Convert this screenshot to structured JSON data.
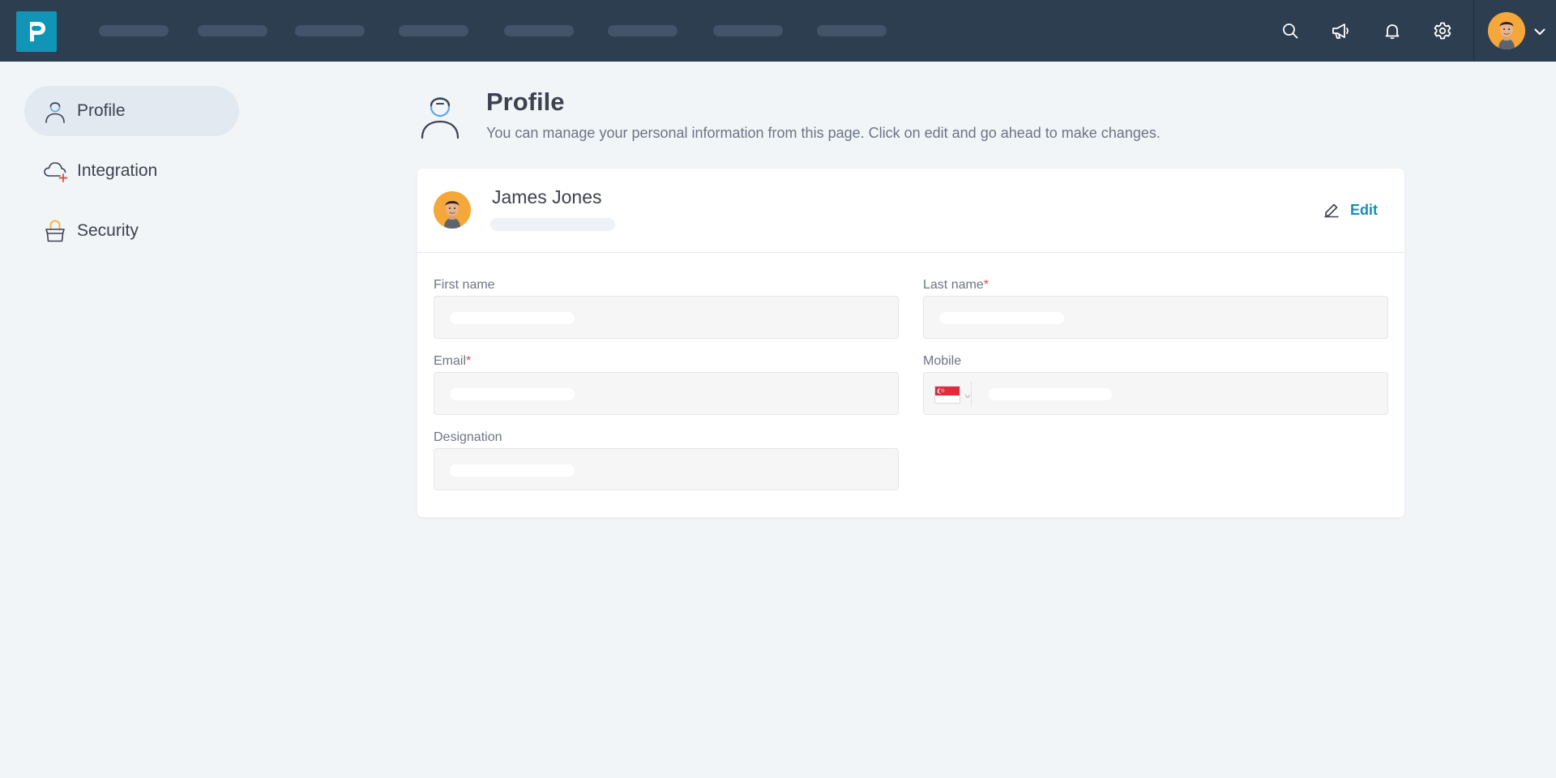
{
  "topbar": {
    "logo_letter": "P",
    "icons": [
      "search-icon",
      "megaphone-icon",
      "bell-icon",
      "gear-icon"
    ],
    "user_menu_icon": "chevron-down-icon"
  },
  "sidebar": {
    "items": [
      {
        "label": "Profile",
        "icon": "user-icon",
        "active": true
      },
      {
        "label": "Integration",
        "icon": "cloud-plus-icon",
        "active": false
      },
      {
        "label": "Security",
        "icon": "lock-icon",
        "active": false
      }
    ]
  },
  "header": {
    "title": "Profile",
    "description": "You can manage your personal information from this page. Click on edit and go ahead to make changes."
  },
  "profile_card": {
    "name": "James Jones",
    "edit_label": "Edit",
    "fields": {
      "first_name": {
        "label": "First name",
        "required": false
      },
      "last_name": {
        "label": "Last name",
        "required": true
      },
      "email": {
        "label": "Email",
        "required": true
      },
      "mobile": {
        "label": "Mobile",
        "required": false,
        "country": "SG"
      },
      "designation": {
        "label": "Designation",
        "required": false
      }
    },
    "required_marker": "*"
  },
  "colors": {
    "topbar_bg": "#2d3e51",
    "logo_bg": "#1195b7",
    "accent": "#1a8db5",
    "required": "#e2493c",
    "page_bg": "#f1f5f8",
    "avatar_bg": "#f6a73a"
  }
}
